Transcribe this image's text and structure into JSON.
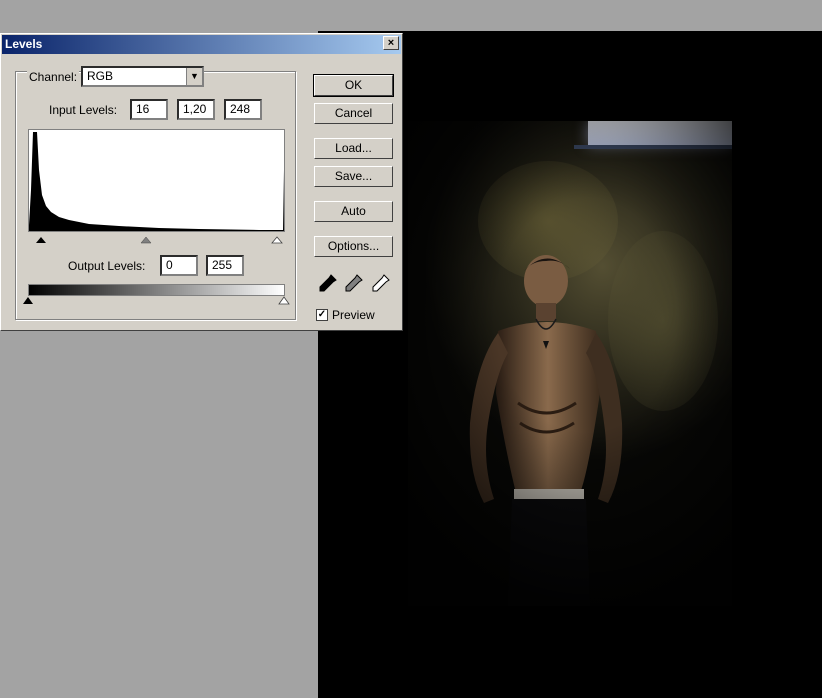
{
  "dialog": {
    "title": "Levels",
    "close_glyph": "×",
    "channel_label": "Channel:",
    "channel_value": "RGB",
    "input_levels_label": "Input Levels:",
    "input_levels": [
      "16",
      "1,20",
      "248"
    ],
    "output_levels_label": "Output Levels:",
    "output_levels": [
      "0",
      "255"
    ],
    "buttons": {
      "ok": "OK",
      "cancel": "Cancel",
      "load": "Load...",
      "save": "Save...",
      "auto": "Auto",
      "options": "Options..."
    },
    "preview_label": "Preview",
    "preview_checked": true,
    "eyedroppers": [
      "black-point-eyedropper-icon",
      "gray-point-eyedropper-icon",
      "white-point-eyedropper-icon"
    ]
  },
  "canvas": {
    "image_description_icon": "photo-image"
  }
}
